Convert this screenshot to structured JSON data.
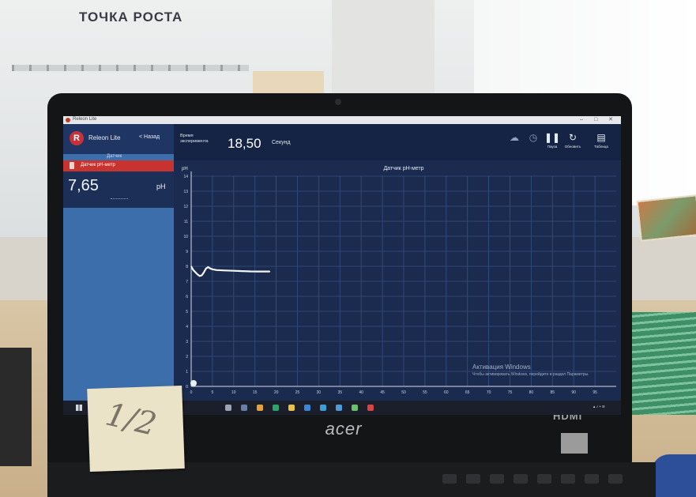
{
  "room": {
    "sign_text": "ТОЧКА РОСТА"
  },
  "laptop": {
    "brand": "acer",
    "port_label": "HDMI"
  },
  "app": {
    "window_title": "Releon Lite",
    "name": "Releon Lite",
    "back_label": "< Назад",
    "sensors_header": "Датчик",
    "sensor_label": "Датчик pH-метр",
    "reading_value": "7,65",
    "reading_unit": "pH",
    "time_caption": "Время эксперимента",
    "time_value": "18,50",
    "time_unit": "Секунд",
    "toolbar": {
      "pause_label": "Пауза",
      "refresh_label": "Обновить",
      "table_label": "Таблица"
    },
    "watermark_title": "Активация Windows",
    "watermark_sub": "Чтобы активировать Windows, перейдите в раздел Параметры."
  },
  "chart_data": {
    "type": "line",
    "title": "Датчик pH-метр",
    "ylabel": "pH",
    "xlabel": "",
    "ylim": [
      0,
      14
    ],
    "xlim": [
      0,
      100
    ],
    "y_ticks": [
      0,
      1,
      2,
      3,
      4,
      5,
      6,
      7,
      8,
      9,
      10,
      11,
      12,
      13,
      14
    ],
    "x_ticks": [
      0,
      5,
      10,
      15,
      20,
      25,
      30,
      35,
      40,
      45,
      50,
      55,
      60,
      65,
      70,
      75,
      80,
      85,
      90,
      95
    ],
    "grid": true,
    "series": [
      {
        "color": "#f4f4f4",
        "x": [
          0,
          0.5,
          1.0,
          1.5,
          2.0,
          2.5,
          3.0,
          3.5,
          4.0,
          4.5,
          5.0,
          6.0,
          8.0,
          10.0,
          12.0,
          14.0,
          16.0,
          18.5
        ],
        "y": [
          8.0,
          7.75,
          7.6,
          7.45,
          7.35,
          7.4,
          7.6,
          7.85,
          7.95,
          7.85,
          7.8,
          7.75,
          7.72,
          7.7,
          7.68,
          7.66,
          7.65,
          7.65
        ]
      }
    ]
  },
  "sticky_note": {
    "text": "1/2"
  }
}
